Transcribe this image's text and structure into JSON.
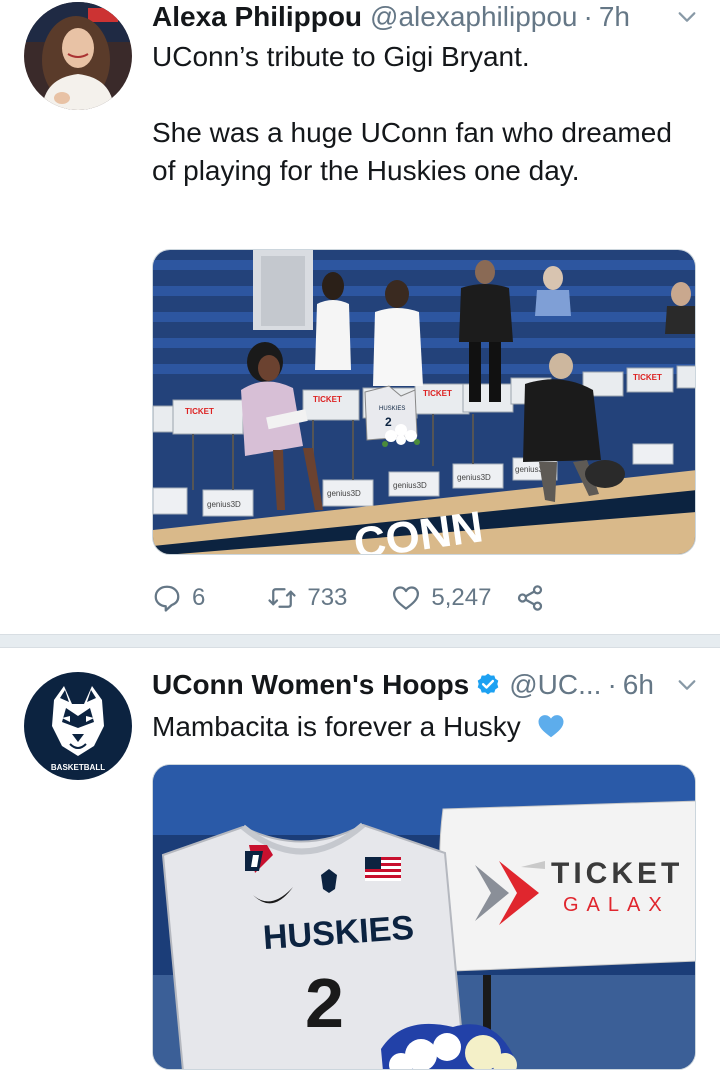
{
  "tweets": [
    {
      "display_name": "Alexa Philippou",
      "handle": "@alexaphilippou",
      "separator": "·",
      "time": "7h",
      "text_line1": "UConn’s tribute to Gigi Bryant.",
      "text_line2": "She was a huge UConn fan who dreamed of playing for the Huskies one day.",
      "photo": {
        "ticket_text": "TICKET",
        "sponsor_text": "genius3D",
        "floor_text": "CONN",
        "jersey_text": "HUSKIES",
        "jersey_number": "2"
      },
      "actions": {
        "reply_count": "6",
        "retweet_count": "733",
        "like_count": "5,247"
      }
    },
    {
      "display_name": "UConn Women's Hoops",
      "handle": "@UC...",
      "separator": "·",
      "time": "6h",
      "text": "Mambacita is forever a Husky",
      "avatar_label": "BASKETBALL",
      "photo": {
        "ticket_line1": "TICKET",
        "ticket_line2": "GALAX",
        "jersey_text": "HUSKIES",
        "jersey_number": "2"
      }
    }
  ],
  "colors": {
    "text": "#14171a",
    "muted": "#657786",
    "verified": "#1da1f2",
    "heart_emoji": "#5dadec",
    "divider": "#e6ecf0",
    "uconn_navy": "#0c2340"
  }
}
